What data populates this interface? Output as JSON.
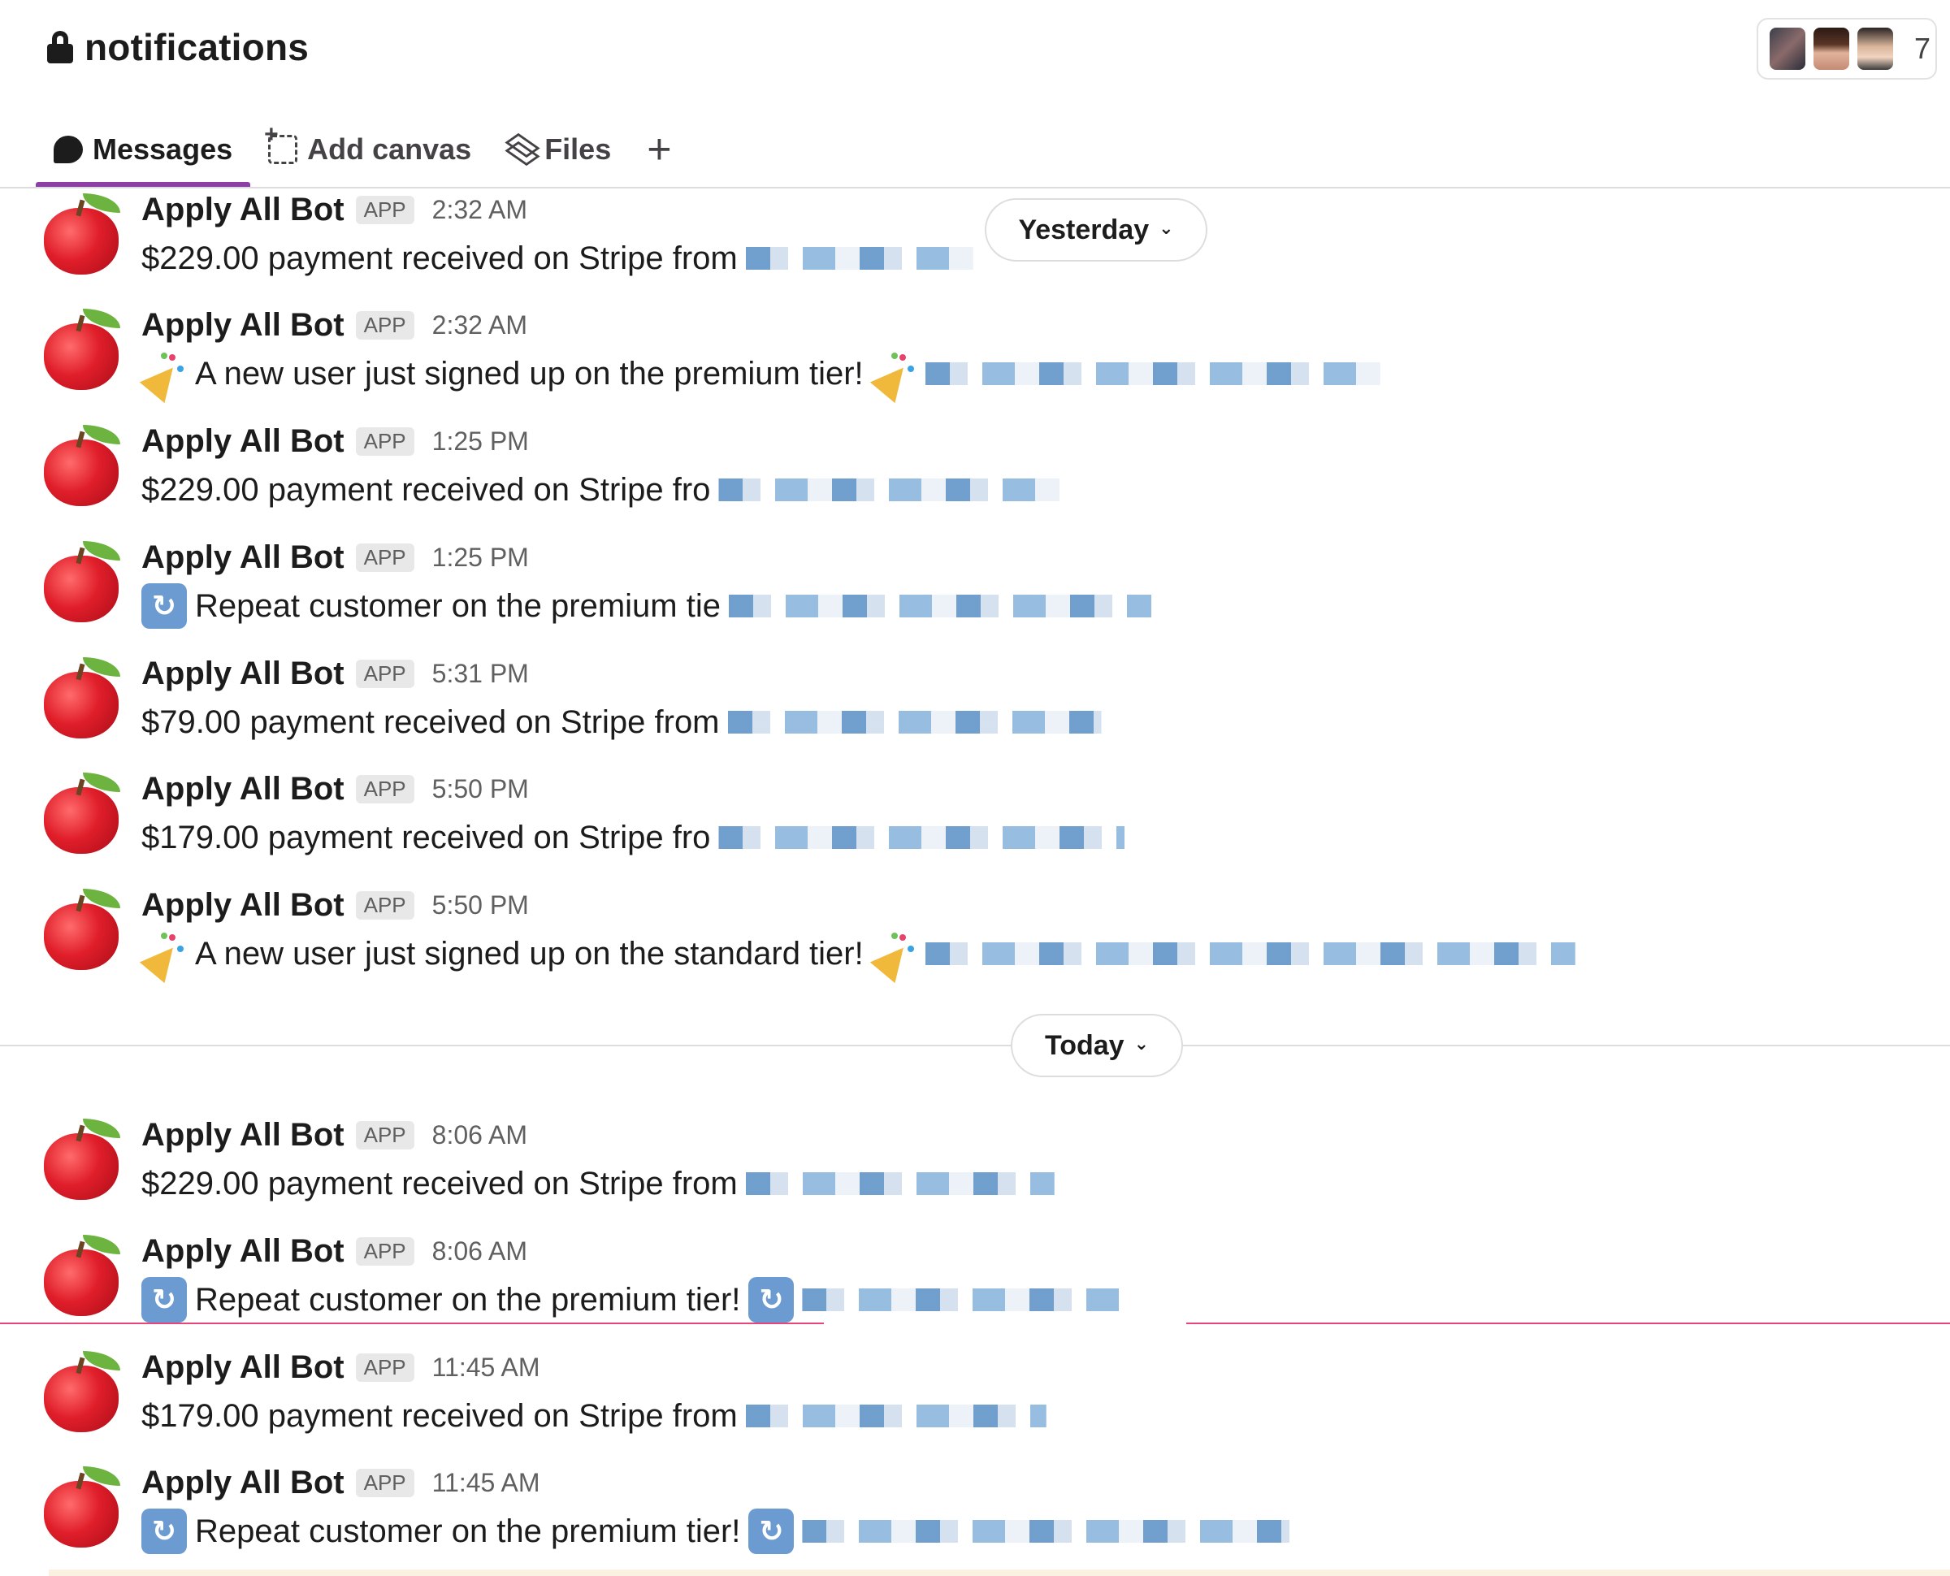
{
  "channel": {
    "name": "notifications",
    "member_count": "7"
  },
  "tabs": [
    {
      "label": "Messages",
      "active": true,
      "icon": "message-bubble-icon"
    },
    {
      "label": "Add canvas",
      "active": false,
      "icon": "canvas-icon"
    },
    {
      "label": "Files",
      "active": false,
      "icon": "layers-icon"
    }
  ],
  "add_tab_label": "+",
  "date_pills": {
    "yesterday": "Yesterday",
    "today": "Today"
  },
  "bot": {
    "name": "Apply All Bot",
    "badge": "APP",
    "avatar_icon": "red-apple-icon"
  },
  "messages": [
    {
      "time": "2:32 AM",
      "text": "$229.00 payment received on Stripe from",
      "emoji_before": "",
      "emoji_after": ""
    },
    {
      "time": "2:32 AM",
      "text": "A new user just signed up on the premium tier!",
      "emoji_before": "party-popper",
      "emoji_after": "party-popper"
    },
    {
      "time": "1:25 PM",
      "text": "$229.00 payment received on Stripe fro",
      "emoji_before": "",
      "emoji_after": ""
    },
    {
      "time": "1:25 PM",
      "text": "Repeat customer on the premium tie",
      "emoji_before": "repeat",
      "emoji_after": ""
    },
    {
      "time": "5:31 PM",
      "text": "$79.00 payment received on Stripe from",
      "emoji_before": "",
      "emoji_after": ""
    },
    {
      "time": "5:50 PM",
      "text": "$179.00 payment received on Stripe fro",
      "emoji_before": "",
      "emoji_after": ""
    },
    {
      "time": "5:50 PM",
      "text": "A new user just signed up on the standard tier!",
      "emoji_before": "party-popper",
      "emoji_after": "party-popper"
    },
    {
      "time": "8:06 AM",
      "text": "$229.00 payment received on Stripe from",
      "emoji_before": "",
      "emoji_after": ""
    },
    {
      "time": "8:06 AM",
      "text": "Repeat customer on the premium tier!",
      "emoji_before": "repeat",
      "emoji_after": "repeat"
    },
    {
      "time": "11:45 AM",
      "text": "$179.00 payment received on Stripe from",
      "emoji_before": "",
      "emoji_after": ""
    },
    {
      "time": "11:45 AM",
      "text": "Repeat customer on the premium tier!",
      "emoji_before": "repeat",
      "emoji_after": "repeat"
    }
  ],
  "colors": {
    "active_tab_underline": "#8d3fa6",
    "new_messages_line": "#e8457b",
    "app_badge_bg": "#e8e8e8"
  }
}
